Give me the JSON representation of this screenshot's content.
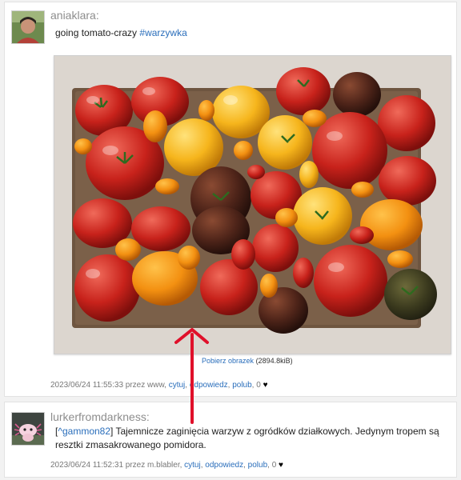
{
  "posts": [
    {
      "username": "aniaklara:",
      "text_prefix": "going tomato-crazy ",
      "hashtag": "#warzywka",
      "download": {
        "link_label": "Pobierz obrazek",
        "size": "(2894.8kiB)"
      },
      "meta": {
        "timestamp": "2023/06/24 11:55:33 przez www,",
        "actions": [
          "cytuj",
          "odpowiedz",
          "polub"
        ],
        "likes": "0"
      },
      "avatar_icon": "user-avatar-photo"
    },
    {
      "username": "lurkerfromdarkness:",
      "reply_to": "^gammon82",
      "text": "Tajemnicze zaginięcia warzyw z ogródków działkowych. Jedynym tropem są resztki zmasakrowanego pomidora.",
      "meta": {
        "timestamp": "2023/06/24 11:52:31 przez m.blabler,",
        "actions": [
          "cytuj",
          "odpowiedz",
          "polub"
        ],
        "likes": "0"
      },
      "avatar_icon": "axolotl-avatar"
    }
  ],
  "colors": {
    "link": "#2a6ebb",
    "annotation_arrow": "#e0102a",
    "username": "#8d8d8d"
  }
}
